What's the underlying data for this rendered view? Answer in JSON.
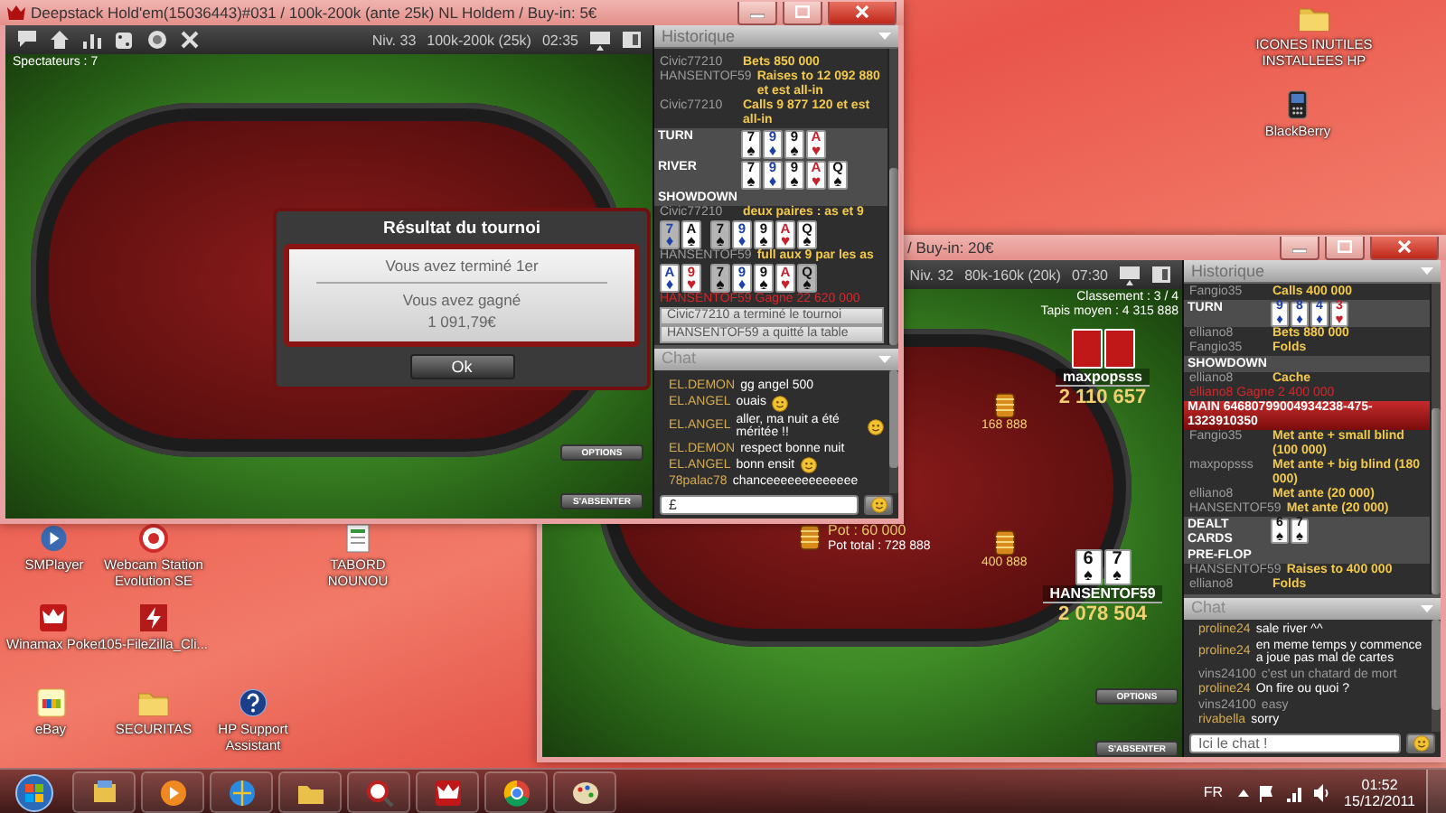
{
  "desktop_icons": [
    {
      "label": "ICONES INUTILES INSTALLEES HP",
      "kind": "folder"
    },
    {
      "label": "BlackBerry",
      "kind": "phone"
    },
    {
      "label": "SMPlayer",
      "kind": "media"
    },
    {
      "label": "Webcam Station Evolution SE",
      "kind": "webcam"
    },
    {
      "label": "TABORD NOUNOU",
      "kind": "document"
    },
    {
      "label": "Winamax Poker",
      "kind": "poker"
    },
    {
      "label": "105-FileZilla_Cli...",
      "kind": "ftp"
    },
    {
      "label": "eBay",
      "kind": "shop"
    },
    {
      "label": "SECURITAS",
      "kind": "folder"
    },
    {
      "label": "HP Support Assistant",
      "kind": "help"
    }
  ],
  "windows": [
    {
      "title": "Deepstack Hold'em(15036443)#031 / 100k-200k (ante 25k) NL Holdem  / Buy-in: 5€",
      "toolbar": {
        "level": "Niv. 33",
        "blinds": "100k-200k (25k)",
        "clock": "02:35"
      },
      "spectators": "Spectateurs : 7",
      "dialog": {
        "title": "Résultat du tournoi",
        "lines": [
          "Vous avez terminé 1er",
          "Vous avez gagné",
          "1 091,79€"
        ],
        "button": "Ok"
      },
      "buttons": [
        "OPTIONS",
        "S'ABSENTER"
      ],
      "history": {
        "title": "Historique",
        "entries": [
          {
            "kind": "action",
            "name": "Civic77210",
            "text": "Bets 850 000"
          },
          {
            "kind": "action",
            "name": "HANSENTOF59",
            "text": "Raises to 12 092 880 et est all-in"
          },
          {
            "kind": "action",
            "name": "Civic77210",
            "text": "Calls 9 877 120 et est all-in"
          },
          {
            "kind": "street",
            "label": "TURN",
            "cards": [
              {
                "rank": "7",
                "suit": "♠",
                "color": "#111111",
                "dimmed": false
              },
              {
                "rank": "9",
                "suit": "♦",
                "color": "#1c3fa8",
                "dimmed": false
              },
              {
                "rank": "9",
                "suit": "♠",
                "color": "#111111",
                "dimmed": false
              },
              {
                "rank": "A",
                "suit": "♥",
                "color": "#c8202a",
                "dimmed": false
              }
            ]
          },
          {
            "kind": "street",
            "label": "RIVER",
            "cards": [
              {
                "rank": "7",
                "suit": "♠",
                "color": "#111111",
                "dimmed": false
              },
              {
                "rank": "9",
                "suit": "♦",
                "color": "#1c3fa8",
                "dimmed": false
              },
              {
                "rank": "9",
                "suit": "♠",
                "color": "#111111",
                "dimmed": false
              },
              {
                "rank": "A",
                "suit": "♥",
                "color": "#c8202a",
                "dimmed": false
              },
              {
                "rank": "Q",
                "suit": "♠",
                "color": "#111111",
                "dimmed": false
              }
            ]
          },
          {
            "kind": "street",
            "label": "SHOWDOWN"
          },
          {
            "kind": "action",
            "name": "Civic77210",
            "text": "deux paires : as et 9"
          },
          {
            "kind": "hand",
            "hole": [
              {
                "rank": "7",
                "suit": "♦",
                "color": "#1c3fa8",
                "dimmed": true
              },
              {
                "rank": "A",
                "suit": "♠",
                "color": "#111111",
                "dimmed": false
              }
            ],
            "board": [
              {
                "rank": "7",
                "suit": "♠",
                "color": "#111111",
                "dimmed": true
              },
              {
                "rank": "9",
                "suit": "♦",
                "color": "#1c3fa8",
                "dimmed": false
              },
              {
                "rank": "9",
                "suit": "♠",
                "color": "#111111",
                "dimmed": false
              },
              {
                "rank": "A",
                "suit": "♥",
                "color": "#c8202a",
                "dimmed": false
              },
              {
                "rank": "Q",
                "suit": "♠",
                "color": "#111111",
                "dimmed": false
              }
            ]
          },
          {
            "kind": "action",
            "name": "HANSENTOF59",
            "text": "full aux 9 par les as"
          },
          {
            "kind": "hand",
            "hole": [
              {
                "rank": "A",
                "suit": "♦",
                "color": "#1c3fa8",
                "dimmed": false
              },
              {
                "rank": "9",
                "suit": "♥",
                "color": "#c8202a",
                "dimmed": false
              }
            ],
            "board": [
              {
                "rank": "7",
                "suit": "♠",
                "color": "#111111",
                "dimmed": true
              },
              {
                "rank": "9",
                "suit": "♦",
                "color": "#1c3fa8",
                "dimmed": false
              },
              {
                "rank": "9",
                "suit": "♠",
                "color": "#111111",
                "dimmed": false
              },
              {
                "rank": "A",
                "suit": "♥",
                "color": "#c8202a",
                "dimmed": false
              },
              {
                "rank": "Q",
                "suit": "♠",
                "color": "#111111",
                "dimmed": true
              }
            ]
          },
          {
            "kind": "result",
            "text": "HANSENTOF59 Gagne 22 620 000"
          },
          {
            "kind": "notice",
            "text": "Civic77210 a terminé le tournoi"
          },
          {
            "kind": "notice",
            "text": "HANSENTOF59 a quitté la table"
          }
        ]
      },
      "chat": {
        "title": "Chat",
        "messages": [
          {
            "name": "EL.DEMON",
            "text": "gg angel 500",
            "smiley": false,
            "muted": false
          },
          {
            "name": "EL.ANGEL",
            "text": "ouais",
            "smiley": true,
            "muted": false
          },
          {
            "name": "EL.ANGEL",
            "text": "aller, ma nuit a été méritée !!",
            "smiley": true,
            "muted": false
          },
          {
            "name": "EL.DEMON",
            "text": "respect bonne nuit",
            "smiley": false,
            "muted": false
          },
          {
            "name": "EL.ANGEL",
            "text": "bonn ensit",
            "smiley": true,
            "muted": false
          },
          {
            "name": "78palac78",
            "text": "chanceeeeeeeeeeeee",
            "smiley": false,
            "muted": false
          }
        ],
        "input": {
          "value": "£"
        }
      }
    },
    {
      "title": "/ Buy-in: 20€",
      "toolbar": {
        "level": "Niv. 32",
        "blinds": "80k-160k (20k)",
        "clock": "07:30"
      },
      "ranking": "Classement : 3 / 4",
      "average_stack": "Tapis moyen : 4 315 888",
      "players": [
        {
          "name": "maxpopsss",
          "stack": "2 110 657",
          "cards_hidden": true
        },
        {
          "name": "HANSENTOF59",
          "stack": "2 078 504",
          "cards_hidden": false,
          "cards": [
            {
              "rank": "6",
              "suit": "♠",
              "color": "#111111",
              "dimmed": false
            },
            {
              "rank": "7",
              "suit": "♠",
              "color": "#111111",
              "dimmed": false
            }
          ]
        }
      ],
      "bets": [
        "168 888",
        "400 888"
      ],
      "pot": "Pot : 60 000",
      "pot_total": "Pot total : 728 888",
      "buttons": [
        "OPTIONS",
        "S'ABSENTER"
      ],
      "history": {
        "title": "Historique",
        "entries": [
          {
            "kind": "action",
            "name": "Fangio35",
            "text": "Calls 400 000"
          },
          {
            "kind": "street",
            "label": "TURN",
            "cards": [
              {
                "rank": "9",
                "suit": "♦",
                "color": "#1c3fa8",
                "dimmed": false
              },
              {
                "rank": "8",
                "suit": "♦",
                "color": "#1c3fa8",
                "dimmed": false
              },
              {
                "rank": "4",
                "suit": "♦",
                "color": "#1c3fa8",
                "dimmed": false
              },
              {
                "rank": "3",
                "suit": "♥",
                "color": "#c8202a",
                "dimmed": false
              }
            ]
          },
          {
            "kind": "action",
            "name": "elliano8",
            "text": "Bets 880 000"
          },
          {
            "kind": "action",
            "name": "Fangio35",
            "text": "Folds"
          },
          {
            "kind": "street",
            "label": "SHOWDOWN"
          },
          {
            "kind": "action",
            "name": "elliano8",
            "text": "Cache"
          },
          {
            "kind": "result",
            "text": "elliano8 Gagne 2 400 000"
          },
          {
            "kind": "header",
            "text": "MAIN 64680799004934238-475-1323910350"
          },
          {
            "kind": "action",
            "name": "Fangio35",
            "text": "Met ante + small blind (100 000)"
          },
          {
            "kind": "action",
            "name": "maxpopsss",
            "text": "Met ante + big blind (180 000)"
          },
          {
            "kind": "action",
            "name": "elliano8",
            "text": "Met ante (20 000)"
          },
          {
            "kind": "action",
            "name": "HANSENTOF59",
            "text": "Met ante (20 000)"
          },
          {
            "kind": "street",
            "label": "DEALT CARDS",
            "cards": [
              {
                "rank": "6",
                "suit": "♠",
                "color": "#111111",
                "dimmed": false
              },
              {
                "rank": "7",
                "suit": "♠",
                "color": "#111111",
                "dimmed": false
              }
            ]
          },
          {
            "kind": "street",
            "label": "PRE-FLOP"
          },
          {
            "kind": "action",
            "name": "HANSENTOF59",
            "text": "Raises to 400 000"
          },
          {
            "kind": "action",
            "name": "elliano8",
            "text": "Folds"
          }
        ]
      },
      "chat": {
        "title": "Chat",
        "messages": [
          {
            "name": "proline24",
            "text": "sale river ^^",
            "smiley": false,
            "muted": false
          },
          {
            "name": "proline24",
            "text": "en meme temps y commence a joue pas mal de cartes",
            "smiley": false,
            "muted": false
          },
          {
            "name": "vins24100",
            "text": "c'est un chatard de mort",
            "smiley": false,
            "muted": true
          },
          {
            "name": "proline24",
            "text": "On fire ou quoi ?",
            "smiley": false,
            "muted": false
          },
          {
            "name": "vins24100",
            "text": "easy",
            "smiley": false,
            "muted": true
          },
          {
            "name": "rivabella",
            "text": "sorry",
            "smiley": false,
            "muted": false
          }
        ],
        "input": {
          "placeholder": "Ici le chat !"
        }
      }
    }
  ],
  "taskbar": {
    "language": "FR",
    "time": "01:52",
    "date": "15/12/2011"
  }
}
